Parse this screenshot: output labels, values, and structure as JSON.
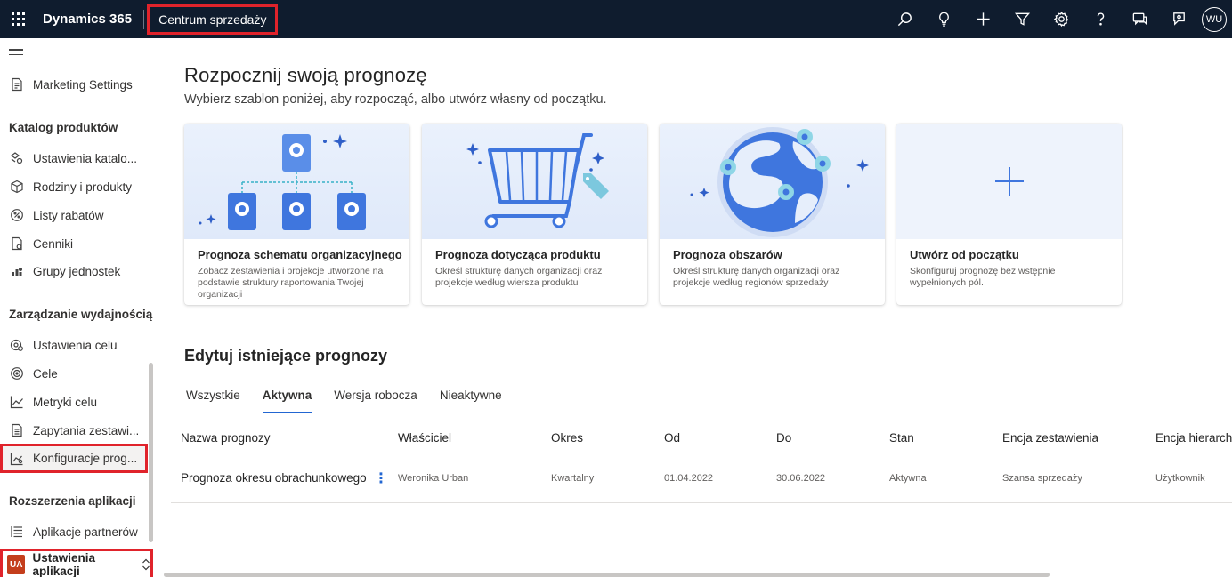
{
  "topbar": {
    "brand": "Dynamics 365",
    "app_name": "Centrum sprzedaży",
    "avatar_initials": "WU",
    "icons": [
      "search-icon",
      "lightbulb-icon",
      "plus-icon",
      "filter-icon",
      "gear-icon",
      "help-icon",
      "chat-icon",
      "feedback-icon"
    ]
  },
  "sidebar": {
    "marketing_settings": "Marketing Settings",
    "groups": {
      "catalog": "Katalog produktów",
      "performance": "Zarządzanie wydajnością",
      "extensions": "Rozszerzenia aplikacji"
    },
    "items": [
      {
        "label": "Ustawienia katalo...",
        "icon": "catalog-settings-icon"
      },
      {
        "label": "Rodziny i produkty",
        "icon": "cube-icon"
      },
      {
        "label": "Listy rabatów",
        "icon": "discount-icon"
      },
      {
        "label": "Cenniki",
        "icon": "price-list-icon"
      },
      {
        "label": "Grupy jednostek",
        "icon": "unit-groups-icon"
      },
      {
        "label": "Ustawienia celu",
        "icon": "goal-settings-icon"
      },
      {
        "label": "Cele",
        "icon": "target-icon"
      },
      {
        "label": "Metryki celu",
        "icon": "metrics-icon"
      },
      {
        "label": "Zapytania zestawi...",
        "icon": "query-icon"
      },
      {
        "label": "Konfiguracje prog...",
        "icon": "forecast-config-icon"
      },
      {
        "label": "Aplikacje partnerów",
        "icon": "partner-apps-icon"
      }
    ],
    "footer": {
      "initials": "UA",
      "label": "Ustawienia aplikacji"
    }
  },
  "main": {
    "title": "Rozpocznij swoją prognozę",
    "subtitle": "Wybierz szablon poniżej, aby rozpocząć, albo utwórz własny od początku.",
    "cards": [
      {
        "title": "Prognoza schematu organizacyjnego",
        "desc": "Zobacz zestawienia i projekcje utworzone na podstawie struktury raportowania Twojej organizacji"
      },
      {
        "title": "Prognoza dotycząca produktu",
        "desc": "Określ strukturę danych organizacji oraz projekcje według wiersza produktu"
      },
      {
        "title": "Prognoza obszarów",
        "desc": "Określ strukturę danych organizacji oraz projekcje według regionów sprzedaży"
      },
      {
        "title": "Utwórz od początku",
        "desc": "Skonfiguruj prognozę bez wstępnie wypełnionych pól."
      }
    ],
    "section_title": "Edytuj istniejące prognozy",
    "tabs": [
      "Wszystkie",
      "Aktywna",
      "Wersja robocza",
      "Nieaktywne"
    ],
    "active_tab": "Aktywna",
    "table": {
      "columns": [
        "Nazwa prognozy",
        "Właściciel",
        "Okres",
        "Od",
        "Do",
        "Stan",
        "Encja zestawienia",
        "Encja hierarchi"
      ],
      "rows": [
        [
          "Prognoza okresu obrachunkowego",
          "Weronika Urban",
          "Kwartalny",
          "01.04.2022",
          "30.06.2022",
          "Aktywna",
          "Szansa sprzedaży",
          "Użytkownik"
        ]
      ]
    }
  },
  "colors": {
    "topbar": "#0f1c2e",
    "accent": "#2266d2",
    "highlight": "#e0232b"
  }
}
